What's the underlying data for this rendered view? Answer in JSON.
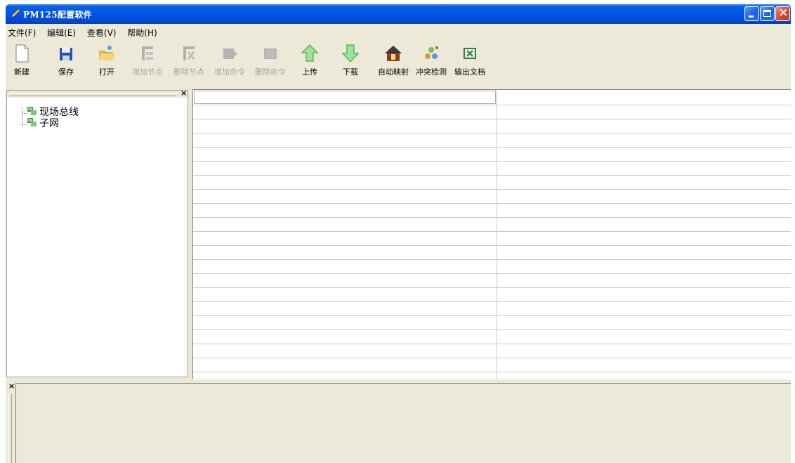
{
  "window": {
    "title": "PM125配置软件"
  },
  "menu": [
    {
      "label": "文件(F)"
    },
    {
      "label": "编辑(E)"
    },
    {
      "label": "查看(V)"
    },
    {
      "label": "帮助(H)"
    }
  ],
  "toolbar": {
    "new": {
      "label": "新建",
      "icon": "new-file-icon"
    },
    "save": {
      "label": "保存",
      "icon": "save-icon"
    },
    "open": {
      "label": "打开",
      "icon": "open-folder-icon"
    },
    "add_node": {
      "label": "增加节点",
      "icon": "add-node-icon"
    },
    "delete_node": {
      "label": "删除节点",
      "icon": "delete-node-icon"
    },
    "add_command": {
      "label": "增加命令",
      "icon": "add-command-icon"
    },
    "delete_command": {
      "label": "删除命令",
      "icon": "delete-command-icon"
    },
    "upload": {
      "label": "上传",
      "icon": "upload-arrow-icon"
    },
    "download": {
      "label": "下载",
      "icon": "download-arrow-icon"
    },
    "auto_map": {
      "label": "自动映射",
      "icon": "house-icon"
    },
    "conflict_check": {
      "label": "冲突检测",
      "icon": "conflict-check-icon"
    },
    "export_doc": {
      "label": "输出文档",
      "icon": "excel-icon"
    }
  },
  "tree": {
    "close_glyph": "×",
    "nodes": [
      {
        "label": "现场总线",
        "icon": "network-node-icon"
      },
      {
        "label": "子网",
        "icon": "network-node-icon"
      }
    ]
  },
  "grid": {
    "rows": 19,
    "columns": 2
  },
  "bottom_panel": {
    "close_glyph": "×"
  },
  "colors": {
    "titlebar": "#0055e5",
    "window_bg": "#ece9d8",
    "disabled_text": "#a8a8a8"
  }
}
